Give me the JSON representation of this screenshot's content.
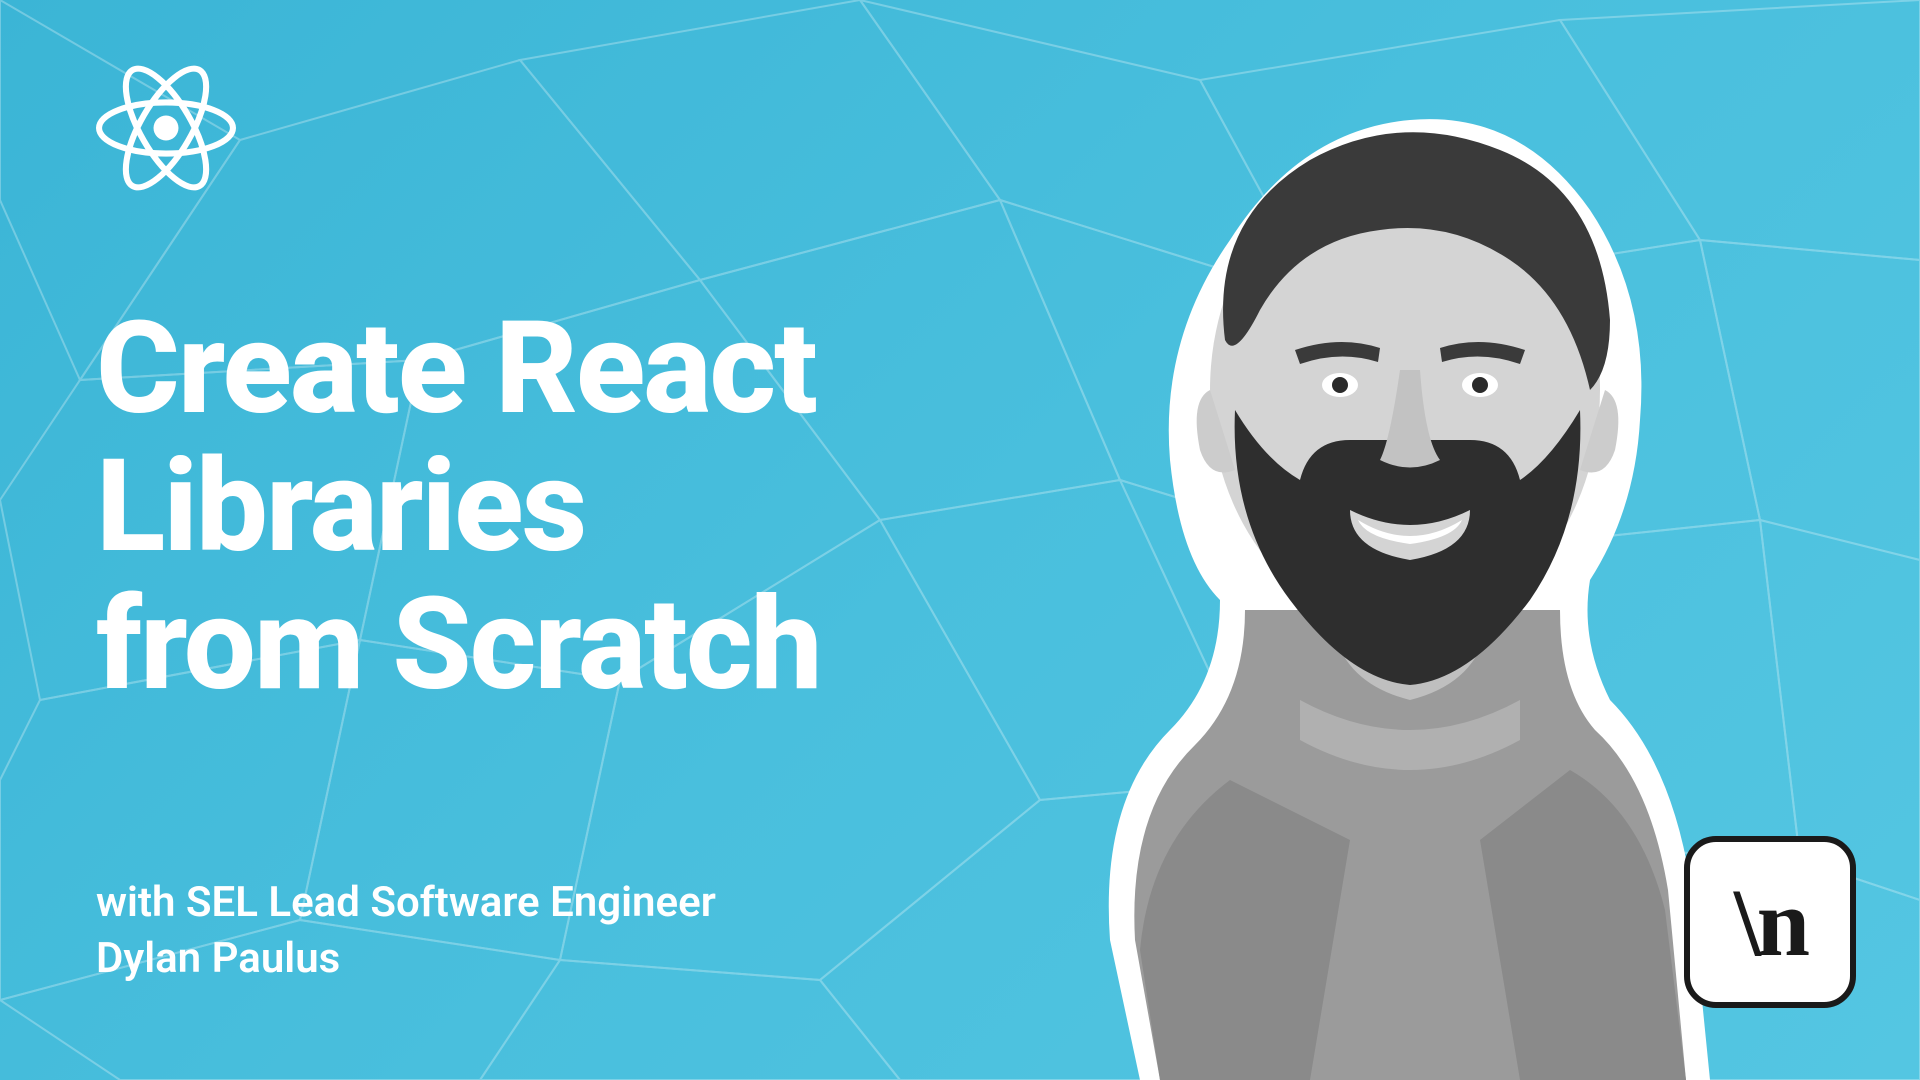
{
  "title_line1": "Create React",
  "title_line2": "Libraries",
  "title_line3": "from Scratch",
  "byline_line1": "with SEL Lead Software Engineer",
  "byline_line2": "Dylan Paulus",
  "brand_text": "\\n",
  "colors": {
    "background_start": "#3bb5d6",
    "background_end": "#54c6e2",
    "text": "#ffffff",
    "badge_border": "#1a1a1a"
  }
}
